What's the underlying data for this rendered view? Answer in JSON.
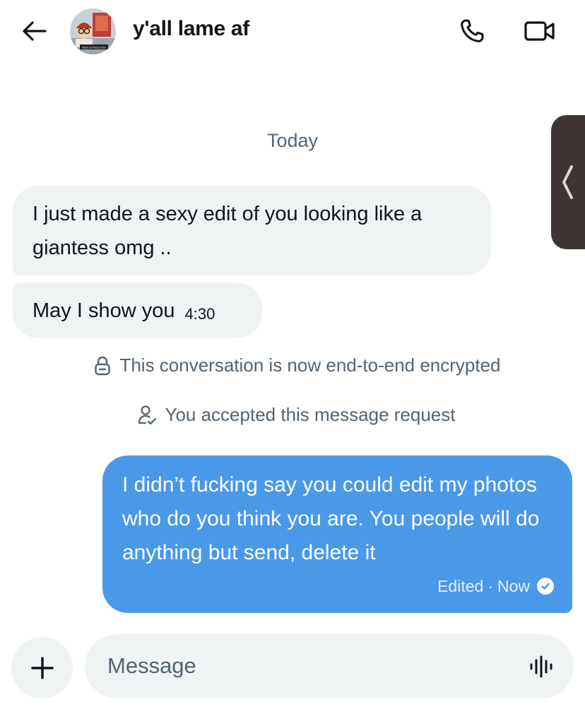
{
  "header": {
    "title": "y'all lame af",
    "avatar_caption": "Beat us these bois"
  },
  "conversation": {
    "day_separator": "Today",
    "incoming": [
      {
        "text": "I just made a sexy edit of you looking like a giantess omg .."
      },
      {
        "text": "May I show you",
        "time": "4:30"
      }
    ],
    "system": [
      {
        "icon": "lock-icon",
        "text": "This conversation is now end-to-end encrypted"
      },
      {
        "icon": "person-check-icon",
        "text": "You accepted this message request"
      }
    ],
    "outgoing": [
      {
        "text": "I didn’t fucking say you could edit my photos who do you think you are. You people will do anything but send, delete it",
        "edited": "Edited",
        "separator": "·",
        "time": "Now"
      }
    ]
  },
  "composer": {
    "placeholder": "Message"
  },
  "colors": {
    "accent": "#4a99e9",
    "bubble_incoming": "#eff3f4",
    "muted_text": "#536471",
    "side_tab": "#3d3433"
  }
}
